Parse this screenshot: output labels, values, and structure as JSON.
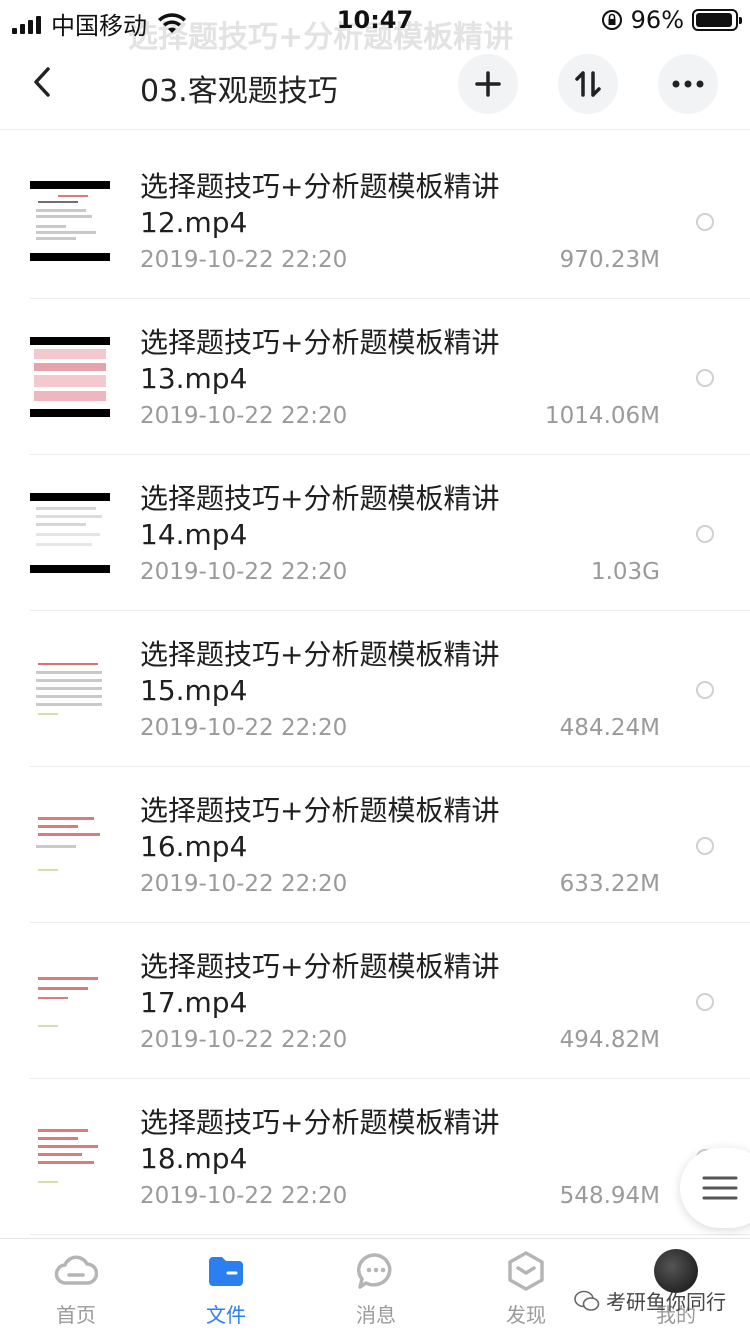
{
  "status_bar": {
    "carrier": "中国移动",
    "time": "10:47",
    "battery_percent_label": "96%",
    "battery_level": 0.96
  },
  "ghost_title": "选择题技巧+分析题模板精讲",
  "header": {
    "title": "03.客观题技巧",
    "back_icon": "chevron-left-icon",
    "add_icon": "plus-icon",
    "sort_icon": "sort-arrows-icon",
    "more_icon": "more-dots-icon"
  },
  "files": [
    {
      "name": "选择题技巧+分析题模板精讲12.mp4",
      "date": "2019-10-22 22:20",
      "size": "970.23M"
    },
    {
      "name": "选择题技巧+分析题模板精讲13.mp4",
      "date": "2019-10-22 22:20",
      "size": "1014.06M"
    },
    {
      "name": "选择题技巧+分析题模板精讲14.mp4",
      "date": "2019-10-22 22:20",
      "size": "1.03G"
    },
    {
      "name": "选择题技巧+分析题模板精讲15.mp4",
      "date": "2019-10-22 22:20",
      "size": "484.24M"
    },
    {
      "name": "选择题技巧+分析题模板精讲16.mp4",
      "date": "2019-10-22 22:20",
      "size": "633.22M"
    },
    {
      "name": "选择题技巧+分析题模板精讲17.mp4",
      "date": "2019-10-22 22:20",
      "size": "494.82M"
    },
    {
      "name": "选择题技巧+分析题模板精讲18.mp4",
      "date": "2019-10-22 22:20",
      "size": "548.94M"
    }
  ],
  "tabs": [
    {
      "label": "首页",
      "icon": "cloud-icon"
    },
    {
      "label": "文件",
      "icon": "folder-icon",
      "active": true
    },
    {
      "label": "消息",
      "icon": "chat-bubble-icon"
    },
    {
      "label": "发现",
      "icon": "hexagon-icon"
    },
    {
      "label": "我的",
      "icon": "avatar"
    }
  ],
  "watermark": "考研鱼你同行",
  "colors": {
    "accent": "#2b7ff0",
    "text_primary": "#1f1f1f",
    "text_secondary": "#9a9a9a"
  }
}
